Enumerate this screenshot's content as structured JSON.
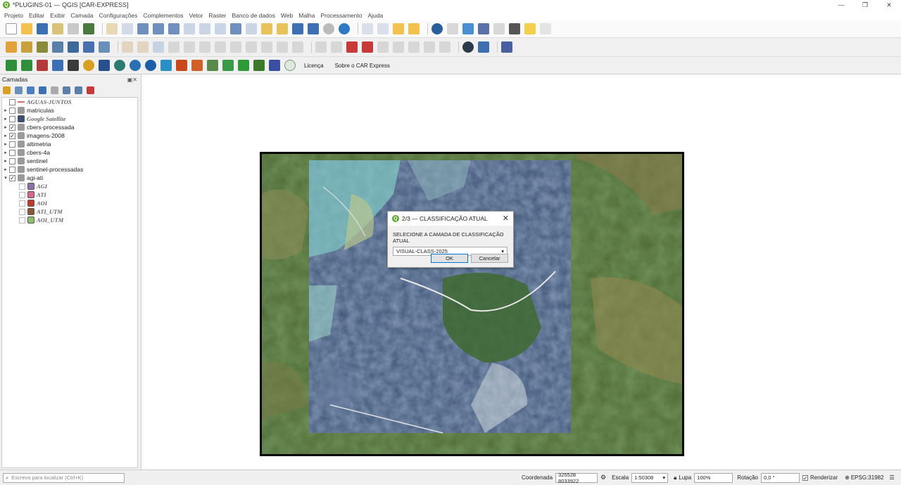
{
  "window": {
    "title": "*PLUGINS-01 — QGIS [CAR-EXPRESS]"
  },
  "menu": [
    "Projeto",
    "Editar",
    "Exibir",
    "Camada",
    "Configurações",
    "Complementos",
    "Vetor",
    "Raster",
    "Banco de dados",
    "Web",
    "Malha",
    "Processamento",
    "Ajuda"
  ],
  "plugin_toolbar": {
    "license_label": "Licença",
    "about_label": "Sobre o CAR Express"
  },
  "layers_panel": {
    "title": "Camadas",
    "layers": [
      {
        "name": "AGUAS-JUNTOS",
        "checked": false,
        "expandable": false,
        "style": "italic",
        "icon_color": "#e06b6b"
      },
      {
        "name": "matriculas",
        "checked": false,
        "expandable": true,
        "style": "normal",
        "icon_color": "#9a9a9a"
      },
      {
        "name": "Google Satellite",
        "checked": false,
        "expandable": true,
        "style": "italic",
        "icon_color": "#3d4f6e"
      },
      {
        "name": "cbers-processada",
        "checked": true,
        "expandable": true,
        "style": "normal",
        "icon_color": "#9a9a9a"
      },
      {
        "name": "imagens-2008",
        "checked": true,
        "expandable": true,
        "style": "normal",
        "icon_color": "#9a9a9a"
      },
      {
        "name": "altimetria",
        "checked": false,
        "expandable": true,
        "style": "normal",
        "icon_color": "#9a9a9a"
      },
      {
        "name": "cbers-4a",
        "checked": false,
        "expandable": true,
        "style": "normal",
        "icon_color": "#9a9a9a"
      },
      {
        "name": "sentinel",
        "checked": false,
        "expandable": true,
        "style": "normal",
        "icon_color": "#9a9a9a"
      },
      {
        "name": "sentinel-processadas",
        "checked": false,
        "expandable": true,
        "style": "normal",
        "icon_color": "#9a9a9a"
      },
      {
        "name": "agi-ati",
        "checked": true,
        "expandable": true,
        "expanded": true,
        "style": "normal",
        "icon_color": "#9a9a9a"
      }
    ],
    "children": [
      {
        "name": "AGI",
        "icon_color": "#8e6fae"
      },
      {
        "name": "ATI",
        "icon_color": "#d46a8e"
      },
      {
        "name": "AOI",
        "icon_color": "#c0392b"
      },
      {
        "name": "ATI_UTM",
        "icon_color": "#8a5a3b"
      },
      {
        "name": "AOI_UTM",
        "icon_color": "#8fbf6b"
      }
    ]
  },
  "dialog": {
    "title": "2/3 — CLASSIFICAÇÃO ATUAL",
    "label": "SELECIONE A CAMADA DE CLASSIFICAÇÃO ATUAL",
    "selected": "VISUAL-CLASS-2025",
    "ok": "OK",
    "cancel": "Cancelar"
  },
  "status": {
    "search_placeholder": "Escreva para localizar (Ctrl+K)",
    "coord_label": "Coordenada",
    "coord_value": "325528 8033922",
    "scale_label": "Escala",
    "scale_value": "1:50308",
    "magnifier_label": "Lupa",
    "magnifier_value": "100%",
    "rotation_label": "Rotação",
    "rotation_value": "0,0 °",
    "render_label": "Renderizar",
    "crs": "EPSG:31982"
  }
}
